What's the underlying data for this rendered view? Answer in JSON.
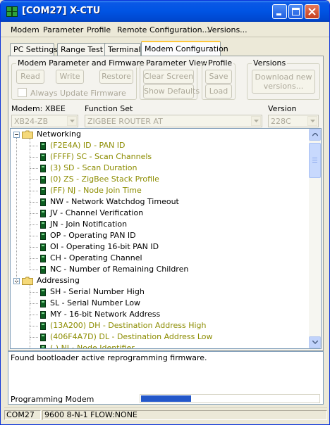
{
  "window": {
    "title": "[COM27] X-CTU"
  },
  "menu": [
    "Modem",
    "Parameter",
    "Profile",
    "Remote Configuration...",
    "Versions..."
  ],
  "tabs": [
    "PC Settings",
    "Range Test",
    "Terminal",
    "Modem Configuration"
  ],
  "active_tab": "Modem Configuration",
  "groups": {
    "modem_param": {
      "title": "Modem Parameter and Firmware",
      "read": "Read",
      "write": "Write",
      "restore": "Restore",
      "always_update": "Always Update Firmware"
    },
    "param_view": {
      "title": "Parameter View",
      "clear_screen": "Clear Screen",
      "show_defaults": "Show Defaults"
    },
    "profile": {
      "title": "Profile",
      "save": "Save",
      "load": "Load"
    },
    "versions": {
      "title": "Versions",
      "download": "Download new versions..."
    }
  },
  "selectors": {
    "modem_label": "Modem: XBEE",
    "modem_value": "XB24-ZB",
    "function_label": "Function Set",
    "function_value": "ZIGBEE ROUTER AT",
    "version_label": "Version",
    "version_value": "228C"
  },
  "tree": [
    {
      "type": "folder",
      "label": "Networking"
    },
    {
      "type": "param",
      "label": "(F2E4A) ID - PAN ID",
      "changed": true
    },
    {
      "type": "param",
      "label": "(FFFF) SC - Scan Channels",
      "changed": true
    },
    {
      "type": "param",
      "label": "(3) SD - Scan Duration",
      "changed": true
    },
    {
      "type": "param",
      "label": "(0) ZS - ZigBee Stack Profile",
      "changed": true
    },
    {
      "type": "param",
      "label": "(FF) NJ - Node Join Time",
      "changed": true
    },
    {
      "type": "param",
      "label": "NW - Network Watchdog Timeout",
      "changed": false
    },
    {
      "type": "param",
      "label": "JV - Channel Verification",
      "changed": false
    },
    {
      "type": "param",
      "label": "JN - Join Notification",
      "changed": false
    },
    {
      "type": "param",
      "label": "OP - Operating PAN ID",
      "changed": false
    },
    {
      "type": "param",
      "label": "OI - Operating 16-bit PAN ID",
      "changed": false
    },
    {
      "type": "param",
      "label": "CH - Operating Channel",
      "changed": false
    },
    {
      "type": "param",
      "label": "NC - Number of Remaining Children",
      "changed": false
    },
    {
      "type": "folder",
      "label": "Addressing"
    },
    {
      "type": "param",
      "label": "SH - Serial Number High",
      "changed": false
    },
    {
      "type": "param",
      "label": "SL - Serial Number Low",
      "changed": false
    },
    {
      "type": "param",
      "label": "MY - 16-bit Network Address",
      "changed": false
    },
    {
      "type": "param",
      "label": "(13A200) DH - Destination Address High",
      "changed": true
    },
    {
      "type": "param",
      "label": "(406F4A7D) DL - Destination Address Low",
      "changed": true
    },
    {
      "type": "param",
      "label": "( ) NI - Node Identifier",
      "changed": true
    }
  ],
  "message": "Found bootloader active reprogramming firmware.",
  "progress": {
    "label": "Programming Modem",
    "fraction": 0.28
  },
  "status": [
    "COM27",
    "9600 8-N-1  FLOW:NONE"
  ],
  "colors": {
    "changed_param": "#8c8c00",
    "title_bar": "#0054e3",
    "progress_fill": "#2357c9"
  }
}
